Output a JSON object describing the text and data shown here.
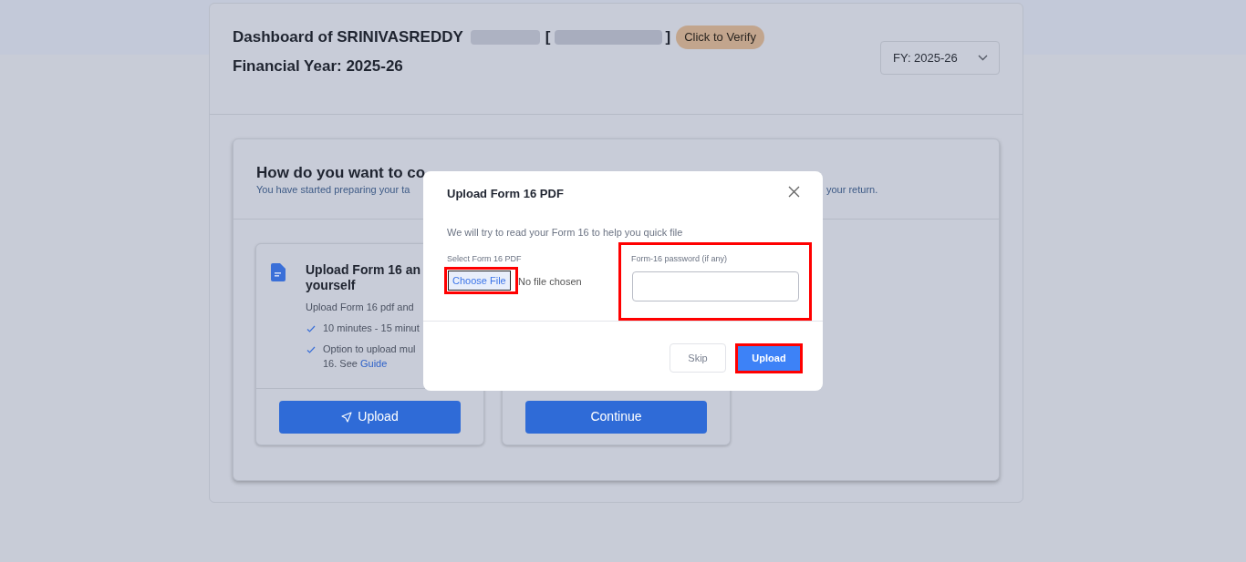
{
  "header": {
    "title": "Dashboard of SRINIVASREDDY",
    "bracket_open": "[",
    "bracket_close": "]",
    "verify_badge": "Click to Verify",
    "financial_year": "Financial Year: 2025-26",
    "fy_select": "FY: 2025-26"
  },
  "continue_panel": {
    "heading": "How do you want to co",
    "subtitle_left": "You have started preparing your ta",
    "subtitle_right": "your return.",
    "options": [
      {
        "kind": "upload",
        "title_lines": [
          "Upload Form 16 an",
          "yourself"
        ],
        "description": "Upload Form 16 pdf and",
        "points": [
          {
            "lines": [
              "10 minutes - 15 minut"
            ]
          },
          {
            "lines": [
              "Option to upload mul",
              "16. See"
            ],
            "link": "Guide"
          }
        ],
        "button": "Upload"
      },
      {
        "kind": "plain",
        "button": "Continue"
      }
    ]
  },
  "modal": {
    "title": "Upload Form 16 PDF",
    "intro": "We will try to read your Form 16 to help you quick file",
    "file_label": "Select Form 16 PDF",
    "file_button": "Choose File",
    "file_status": "No file chosen",
    "file_highlighted": true,
    "password_label": "Form-16 password (if any)",
    "password_highlighted": true,
    "buttons": [
      {
        "label": "Skip",
        "kind": "secondary",
        "highlighted": false
      },
      {
        "label": "Upload",
        "kind": "primary",
        "highlighted": true
      }
    ]
  }
}
